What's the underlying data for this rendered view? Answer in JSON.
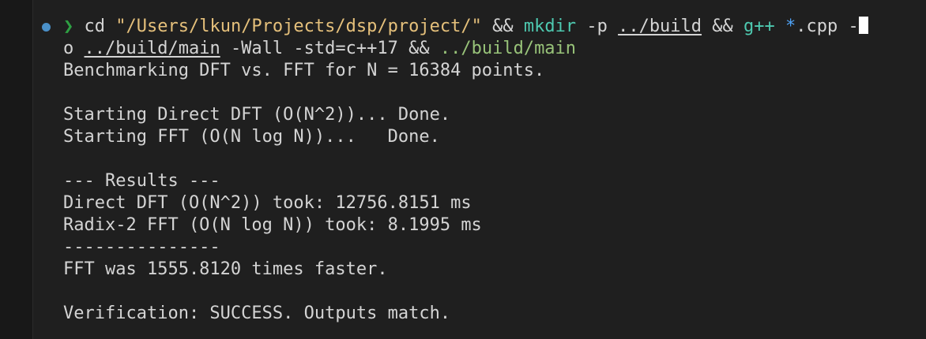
{
  "prompt": {
    "symbol": "❯",
    "cmd_cd": "cd",
    "path_arg": "\"/Users/lkun/Projects/dsp/project/\"",
    "op_and1": "&&",
    "cmd_mkdir": "mkdir",
    "flag_p": "-p",
    "arg_build": "../build",
    "op_and2": "&&",
    "cmd_gpp": "g++",
    "glob_star": "*",
    "glob_ext": ".cpp",
    "flag_o_start": "-",
    "flag_o_end": "o",
    "arg_out": "../build/main",
    "flags_rest": "-Wall -std=c++17",
    "op_and3": "&&",
    "cmd_run": "../build/main"
  },
  "output": {
    "lines": [
      "Benchmarking DFT vs. FFT for N = 16384 points.",
      "",
      "Starting Direct DFT (O(N^2))... Done.",
      "Starting FFT (O(N log N))...   Done.",
      "",
      "--- Results ---",
      "Direct DFT (O(N^2)) took: 12756.8151 ms",
      "Radix-2 FFT (O(N log N)) took: 8.1995 ms",
      "---------------",
      "FFT was 1555.8120 times faster.",
      "",
      "Verification: SUCCESS. Outputs match."
    ]
  }
}
